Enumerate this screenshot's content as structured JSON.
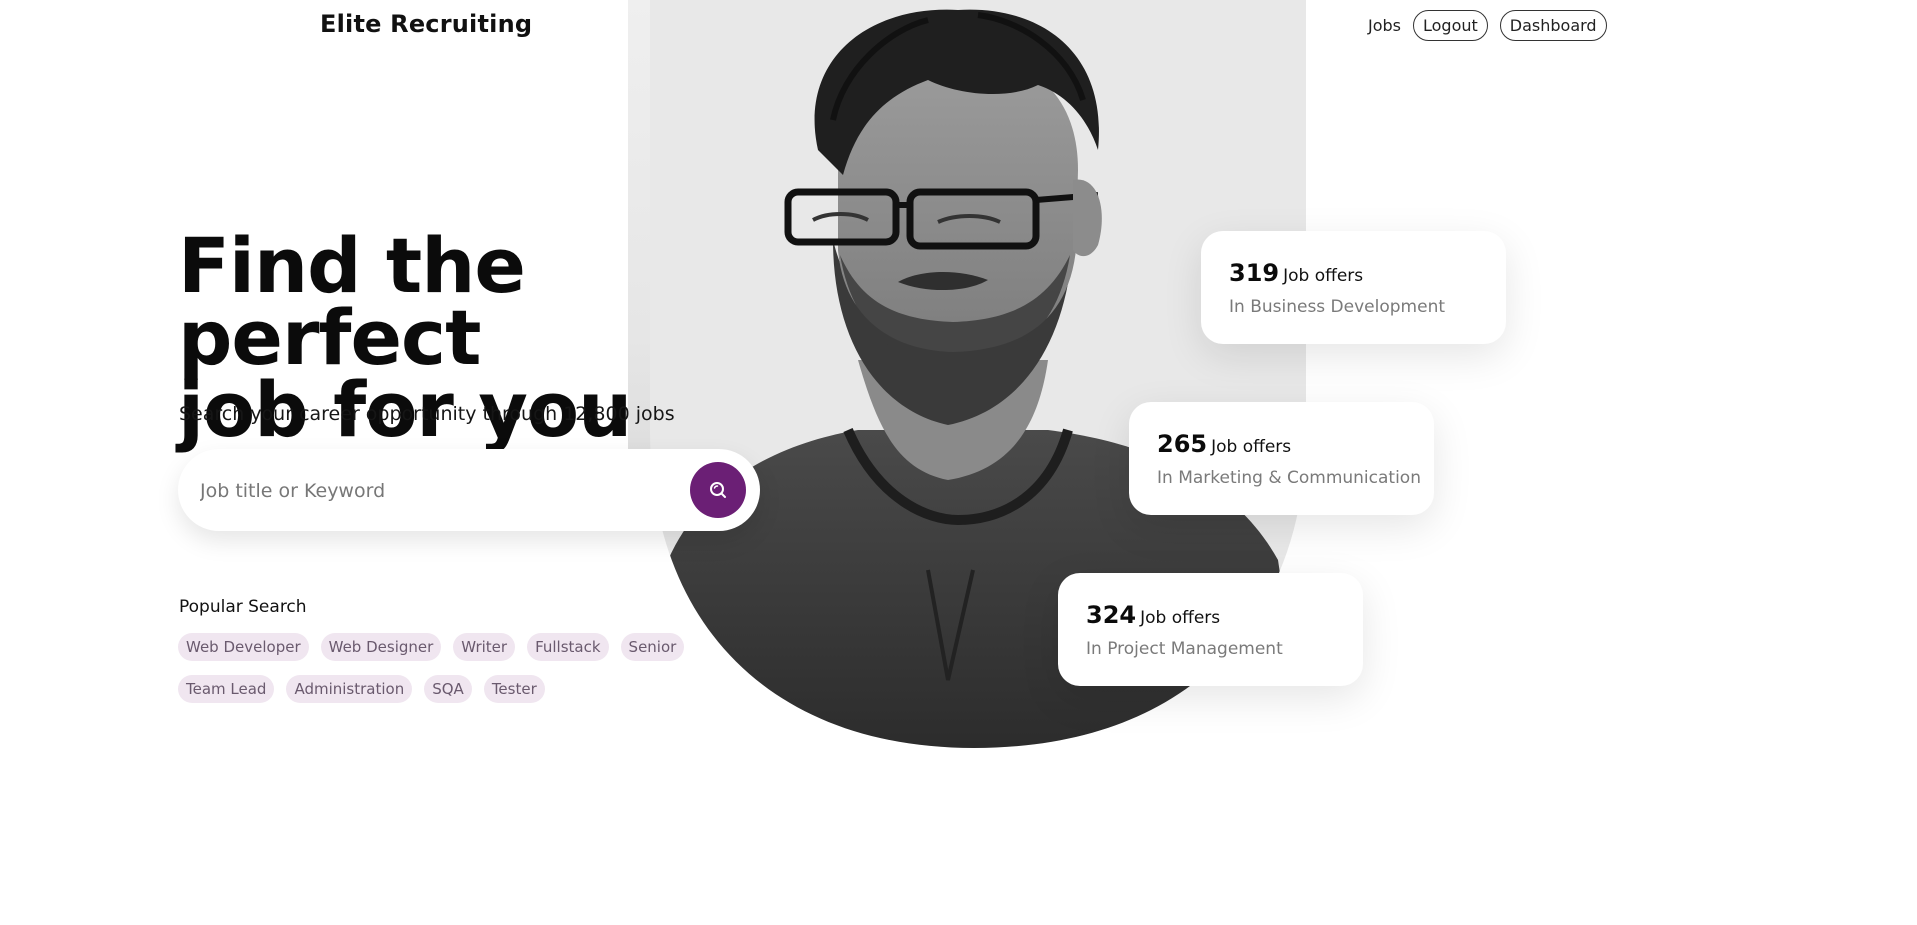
{
  "header": {
    "brand": "Elite Recruiting",
    "nav": {
      "jobs": "Jobs",
      "logout": "Logout",
      "dashboard": "Dashboard"
    }
  },
  "hero": {
    "title_line1": "Find the perfect",
    "title_line2": "job for you",
    "subtitle": "Search your career opportunity through 12,800 jobs",
    "search": {
      "placeholder": "Job title or Keyword",
      "value": ""
    },
    "popular_label": "Popular Search",
    "tags_row1": [
      "Web Developer",
      "Web Designer",
      "Writer",
      "Fullstack",
      "Senior"
    ],
    "tags_row2": [
      "Team Lead",
      "Administration",
      "SQA",
      "Tester"
    ]
  },
  "stats": [
    {
      "count": "319",
      "label": "Job offers",
      "category": "In Business Development"
    },
    {
      "count": "265",
      "label": "Job offers",
      "category": "In Marketing & Communication"
    },
    {
      "count": "324",
      "label": "Job offers",
      "category": "In Project Management"
    }
  ],
  "colors": {
    "accent": "#6b1f75",
    "tag_bg": "#f0e6f0",
    "tag_text": "#6a5a6e"
  },
  "icons": {
    "search_button": "search-icon"
  }
}
